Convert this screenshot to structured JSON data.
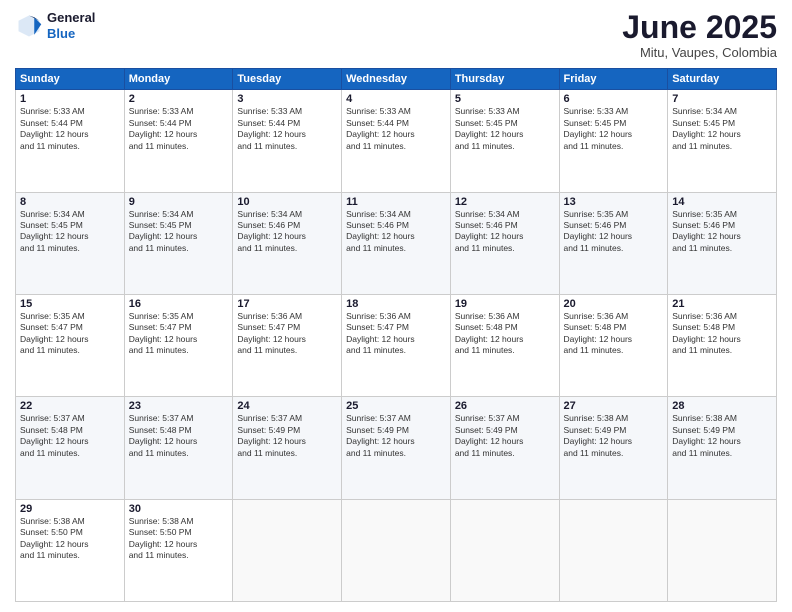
{
  "logo": {
    "line1": "General",
    "line2": "Blue"
  },
  "title": "June 2025",
  "location": "Mitu, Vaupes, Colombia",
  "days_of_week": [
    "Sunday",
    "Monday",
    "Tuesday",
    "Wednesday",
    "Thursday",
    "Friday",
    "Saturday"
  ],
  "weeks": [
    [
      {
        "num": "1",
        "info": "Sunrise: 5:33 AM\nSunset: 5:44 PM\nDaylight: 12 hours\nand 11 minutes."
      },
      {
        "num": "2",
        "info": "Sunrise: 5:33 AM\nSunset: 5:44 PM\nDaylight: 12 hours\nand 11 minutes."
      },
      {
        "num": "3",
        "info": "Sunrise: 5:33 AM\nSunset: 5:44 PM\nDaylight: 12 hours\nand 11 minutes."
      },
      {
        "num": "4",
        "info": "Sunrise: 5:33 AM\nSunset: 5:44 PM\nDaylight: 12 hours\nand 11 minutes."
      },
      {
        "num": "5",
        "info": "Sunrise: 5:33 AM\nSunset: 5:45 PM\nDaylight: 12 hours\nand 11 minutes."
      },
      {
        "num": "6",
        "info": "Sunrise: 5:33 AM\nSunset: 5:45 PM\nDaylight: 12 hours\nand 11 minutes."
      },
      {
        "num": "7",
        "info": "Sunrise: 5:34 AM\nSunset: 5:45 PM\nDaylight: 12 hours\nand 11 minutes."
      }
    ],
    [
      {
        "num": "8",
        "info": "Sunrise: 5:34 AM\nSunset: 5:45 PM\nDaylight: 12 hours\nand 11 minutes."
      },
      {
        "num": "9",
        "info": "Sunrise: 5:34 AM\nSunset: 5:45 PM\nDaylight: 12 hours\nand 11 minutes."
      },
      {
        "num": "10",
        "info": "Sunrise: 5:34 AM\nSunset: 5:46 PM\nDaylight: 12 hours\nand 11 minutes."
      },
      {
        "num": "11",
        "info": "Sunrise: 5:34 AM\nSunset: 5:46 PM\nDaylight: 12 hours\nand 11 minutes."
      },
      {
        "num": "12",
        "info": "Sunrise: 5:34 AM\nSunset: 5:46 PM\nDaylight: 12 hours\nand 11 minutes."
      },
      {
        "num": "13",
        "info": "Sunrise: 5:35 AM\nSunset: 5:46 PM\nDaylight: 12 hours\nand 11 minutes."
      },
      {
        "num": "14",
        "info": "Sunrise: 5:35 AM\nSunset: 5:46 PM\nDaylight: 12 hours\nand 11 minutes."
      }
    ],
    [
      {
        "num": "15",
        "info": "Sunrise: 5:35 AM\nSunset: 5:47 PM\nDaylight: 12 hours\nand 11 minutes."
      },
      {
        "num": "16",
        "info": "Sunrise: 5:35 AM\nSunset: 5:47 PM\nDaylight: 12 hours\nand 11 minutes."
      },
      {
        "num": "17",
        "info": "Sunrise: 5:36 AM\nSunset: 5:47 PM\nDaylight: 12 hours\nand 11 minutes."
      },
      {
        "num": "18",
        "info": "Sunrise: 5:36 AM\nSunset: 5:47 PM\nDaylight: 12 hours\nand 11 minutes."
      },
      {
        "num": "19",
        "info": "Sunrise: 5:36 AM\nSunset: 5:48 PM\nDaylight: 12 hours\nand 11 minutes."
      },
      {
        "num": "20",
        "info": "Sunrise: 5:36 AM\nSunset: 5:48 PM\nDaylight: 12 hours\nand 11 minutes."
      },
      {
        "num": "21",
        "info": "Sunrise: 5:36 AM\nSunset: 5:48 PM\nDaylight: 12 hours\nand 11 minutes."
      }
    ],
    [
      {
        "num": "22",
        "info": "Sunrise: 5:37 AM\nSunset: 5:48 PM\nDaylight: 12 hours\nand 11 minutes."
      },
      {
        "num": "23",
        "info": "Sunrise: 5:37 AM\nSunset: 5:48 PM\nDaylight: 12 hours\nand 11 minutes."
      },
      {
        "num": "24",
        "info": "Sunrise: 5:37 AM\nSunset: 5:49 PM\nDaylight: 12 hours\nand 11 minutes."
      },
      {
        "num": "25",
        "info": "Sunrise: 5:37 AM\nSunset: 5:49 PM\nDaylight: 12 hours\nand 11 minutes."
      },
      {
        "num": "26",
        "info": "Sunrise: 5:37 AM\nSunset: 5:49 PM\nDaylight: 12 hours\nand 11 minutes."
      },
      {
        "num": "27",
        "info": "Sunrise: 5:38 AM\nSunset: 5:49 PM\nDaylight: 12 hours\nand 11 minutes."
      },
      {
        "num": "28",
        "info": "Sunrise: 5:38 AM\nSunset: 5:49 PM\nDaylight: 12 hours\nand 11 minutes."
      }
    ],
    [
      {
        "num": "29",
        "info": "Sunrise: 5:38 AM\nSunset: 5:50 PM\nDaylight: 12 hours\nand 11 minutes."
      },
      {
        "num": "30",
        "info": "Sunrise: 5:38 AM\nSunset: 5:50 PM\nDaylight: 12 hours\nand 11 minutes."
      },
      null,
      null,
      null,
      null,
      null
    ]
  ]
}
